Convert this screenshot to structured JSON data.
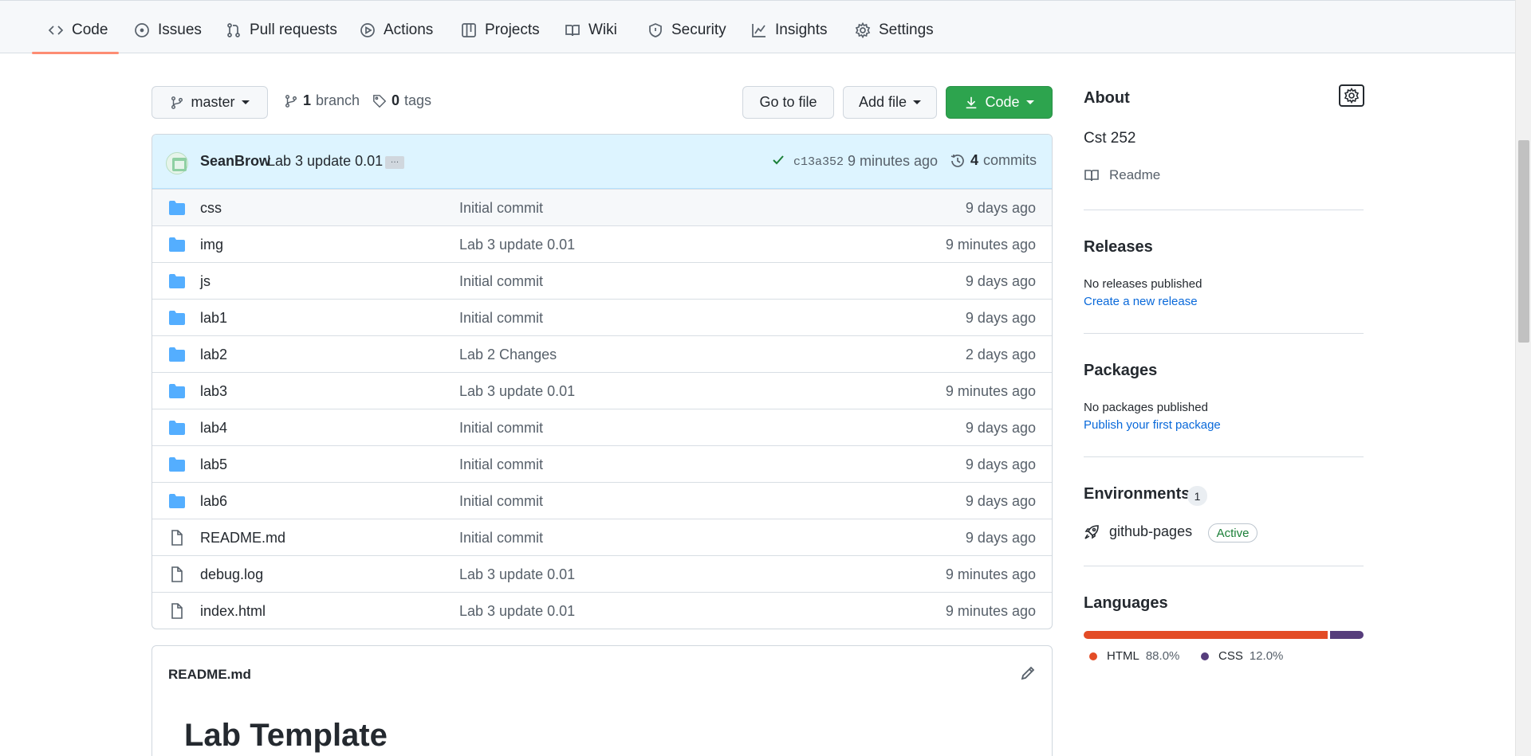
{
  "tabs": [
    {
      "label": "Code",
      "icon": "code-icon"
    },
    {
      "label": "Issues",
      "icon": "issue-icon"
    },
    {
      "label": "Pull requests",
      "icon": "pull-request-icon"
    },
    {
      "label": "Actions",
      "icon": "play-icon"
    },
    {
      "label": "Projects",
      "icon": "table-icon"
    },
    {
      "label": "Wiki",
      "icon": "book-icon"
    },
    {
      "label": "Security",
      "icon": "shield-icon"
    },
    {
      "label": "Insights",
      "icon": "graph-icon"
    },
    {
      "label": "Settings",
      "icon": "gear-icon"
    }
  ],
  "toolbar": {
    "branch": "master",
    "branch_count": "1",
    "branch_label": "branch",
    "tag_count": "0",
    "tag_label": "tags",
    "go_to_file": "Go to file",
    "add_file": "Add file",
    "code": "Code"
  },
  "commit": {
    "author": "SeanBrow",
    "message": "Lab 3 update 0.01",
    "ellipsis": "…",
    "sha": "c13a352",
    "time": "9 minutes ago",
    "count": "4",
    "count_label": "commits"
  },
  "files": [
    {
      "name": "css",
      "type": "folder",
      "message": "Initial commit",
      "time": "9 days ago"
    },
    {
      "name": "img",
      "type": "folder",
      "message": "Lab 3 update 0.01",
      "time": "9 minutes ago"
    },
    {
      "name": "js",
      "type": "folder",
      "message": "Initial commit",
      "time": "9 days ago"
    },
    {
      "name": "lab1",
      "type": "folder",
      "message": "Initial commit",
      "time": "9 days ago"
    },
    {
      "name": "lab2",
      "type": "folder",
      "message": "Lab 2 Changes",
      "time": "2 days ago"
    },
    {
      "name": "lab3",
      "type": "folder",
      "message": "Lab 3 update 0.01",
      "time": "9 minutes ago"
    },
    {
      "name": "lab4",
      "type": "folder",
      "message": "Initial commit",
      "time": "9 days ago"
    },
    {
      "name": "lab5",
      "type": "folder",
      "message": "Initial commit",
      "time": "9 days ago"
    },
    {
      "name": "lab6",
      "type": "folder",
      "message": "Initial commit",
      "time": "9 days ago"
    },
    {
      "name": "README.md",
      "type": "file",
      "message": "Initial commit",
      "time": "9 days ago"
    },
    {
      "name": "debug.log",
      "type": "file",
      "message": "Lab 3 update 0.01",
      "time": "9 minutes ago"
    },
    {
      "name": "index.html",
      "type": "file",
      "message": "Lab 3 update 0.01",
      "time": "9 minutes ago"
    }
  ],
  "readme": {
    "filename": "README.md",
    "heading": "Lab Template"
  },
  "sidebar": {
    "about_title": "About",
    "description": "Cst 252",
    "readme_link": "Readme",
    "releases_title": "Releases",
    "releases_text": "No releases published",
    "releases_link": "Create a new release",
    "packages_title": "Packages",
    "packages_text": "No packages published",
    "packages_link": "Publish your first package",
    "environments_title": "Environments",
    "environments_count": "1",
    "environment_name": "github-pages",
    "environment_status": "Active",
    "languages_title": "Languages",
    "languages": [
      {
        "name": "HTML",
        "percent": "88.0%",
        "value": 88.0,
        "color": "#e34c26"
      },
      {
        "name": "CSS",
        "percent": "12.0%",
        "value": 12.0,
        "color": "#563d7c"
      }
    ]
  },
  "colors": {
    "accent_green": "#2da44e",
    "link_blue": "#0969da",
    "tab_underline": "#fd8c73",
    "folder_blue": "#54aeff"
  }
}
